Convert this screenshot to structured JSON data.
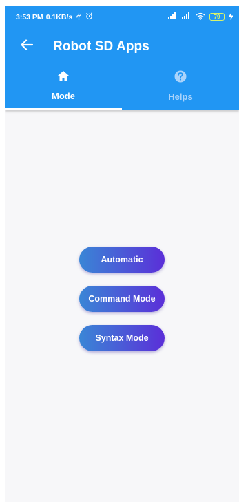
{
  "status_bar": {
    "time": "3:53 PM",
    "speed": "0.1KB/s",
    "battery": "79"
  },
  "app_bar": {
    "title": "Robot SD Apps",
    "back_icon": "arrow-left-icon"
  },
  "tabs": [
    {
      "label": "Mode",
      "icon": "home-icon",
      "active": true
    },
    {
      "label": "Helps",
      "icon": "help-circle-icon",
      "active": false
    }
  ],
  "buttons": [
    {
      "label": "Automatic"
    },
    {
      "label": "Command Mode"
    },
    {
      "label": "Syntax Mode"
    }
  ],
  "colors": {
    "primary": "#2196f3",
    "inactive_tab": "#a9d3fb",
    "background": "#f7f7f9",
    "button_gradient_start": "#3a86d6",
    "button_gradient_end": "#5b2fd8",
    "battery": "#d7f26b"
  }
}
